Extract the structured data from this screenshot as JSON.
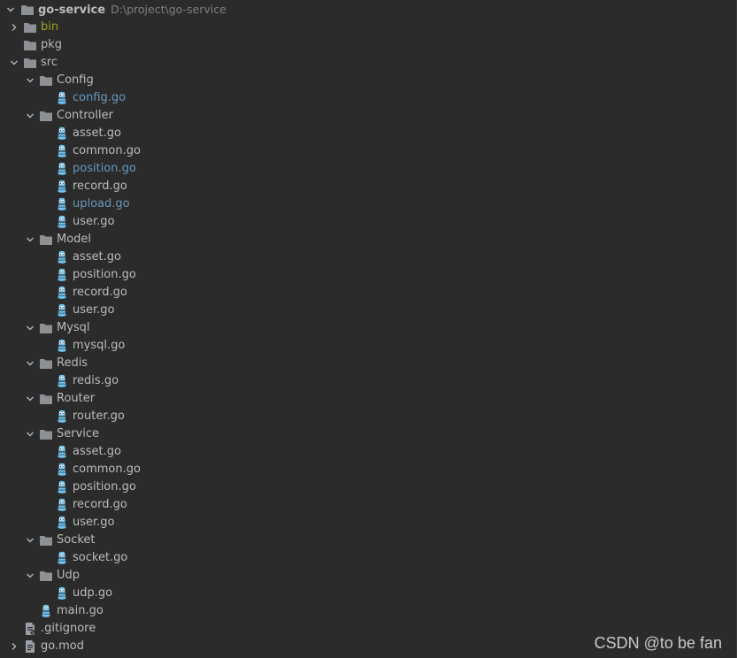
{
  "colors": {
    "background": "#2b2b2b",
    "text": "#bbbbbb",
    "modified_file": "#6897bb",
    "excluded_folder": "#a1a12a",
    "path_hint": "#808080",
    "folder_icon": "#8d9195",
    "go_file_icon": "#6fc3ee"
  },
  "project": {
    "name": "go-service",
    "path": "D:\\project\\go-service"
  },
  "tree": [
    {
      "label": "bin",
      "kind": "folder",
      "level": 1,
      "chevron": "right",
      "style": "excluded"
    },
    {
      "label": "pkg",
      "kind": "folder",
      "level": 1,
      "chevron": "none",
      "style": "normal"
    },
    {
      "label": "src",
      "kind": "folder",
      "level": 1,
      "chevron": "down",
      "style": "normal"
    },
    {
      "label": "Config",
      "kind": "folder",
      "level": 2,
      "chevron": "down",
      "style": "normal"
    },
    {
      "label": "config.go",
      "kind": "go",
      "level": 3,
      "chevron": "none",
      "style": "modified"
    },
    {
      "label": "Controller",
      "kind": "folder",
      "level": 2,
      "chevron": "down",
      "style": "normal"
    },
    {
      "label": "asset.go",
      "kind": "go",
      "level": 3,
      "chevron": "none",
      "style": "normal"
    },
    {
      "label": "common.go",
      "kind": "go",
      "level": 3,
      "chevron": "none",
      "style": "normal"
    },
    {
      "label": "position.go",
      "kind": "go",
      "level": 3,
      "chevron": "none",
      "style": "modified"
    },
    {
      "label": "record.go",
      "kind": "go",
      "level": 3,
      "chevron": "none",
      "style": "normal"
    },
    {
      "label": "upload.go",
      "kind": "go",
      "level": 3,
      "chevron": "none",
      "style": "modified"
    },
    {
      "label": "user.go",
      "kind": "go",
      "level": 3,
      "chevron": "none",
      "style": "normal"
    },
    {
      "label": "Model",
      "kind": "folder",
      "level": 2,
      "chevron": "down",
      "style": "normal"
    },
    {
      "label": "asset.go",
      "kind": "go",
      "level": 3,
      "chevron": "none",
      "style": "normal"
    },
    {
      "label": "position.go",
      "kind": "go",
      "level": 3,
      "chevron": "none",
      "style": "normal"
    },
    {
      "label": "record.go",
      "kind": "go",
      "level": 3,
      "chevron": "none",
      "style": "normal"
    },
    {
      "label": "user.go",
      "kind": "go",
      "level": 3,
      "chevron": "none",
      "style": "normal"
    },
    {
      "label": "Mysql",
      "kind": "folder",
      "level": 2,
      "chevron": "down",
      "style": "normal"
    },
    {
      "label": "mysql.go",
      "kind": "go",
      "level": 3,
      "chevron": "none",
      "style": "normal"
    },
    {
      "label": "Redis",
      "kind": "folder",
      "level": 2,
      "chevron": "down",
      "style": "normal"
    },
    {
      "label": "redis.go",
      "kind": "go",
      "level": 3,
      "chevron": "none",
      "style": "normal"
    },
    {
      "label": "Router",
      "kind": "folder",
      "level": 2,
      "chevron": "down",
      "style": "normal"
    },
    {
      "label": "router.go",
      "kind": "go",
      "level": 3,
      "chevron": "none",
      "style": "normal"
    },
    {
      "label": "Service",
      "kind": "folder",
      "level": 2,
      "chevron": "down",
      "style": "normal"
    },
    {
      "label": "asset.go",
      "kind": "go",
      "level": 3,
      "chevron": "none",
      "style": "normal"
    },
    {
      "label": "common.go",
      "kind": "go",
      "level": 3,
      "chevron": "none",
      "style": "normal"
    },
    {
      "label": "position.go",
      "kind": "go",
      "level": 3,
      "chevron": "none",
      "style": "normal"
    },
    {
      "label": "record.go",
      "kind": "go",
      "level": 3,
      "chevron": "none",
      "style": "normal"
    },
    {
      "label": "user.go",
      "kind": "go",
      "level": 3,
      "chevron": "none",
      "style": "normal"
    },
    {
      "label": "Socket",
      "kind": "folder",
      "level": 2,
      "chevron": "down",
      "style": "normal"
    },
    {
      "label": "socket.go",
      "kind": "go",
      "level": 3,
      "chevron": "none",
      "style": "normal"
    },
    {
      "label": "Udp",
      "kind": "folder",
      "level": 2,
      "chevron": "down",
      "style": "normal"
    },
    {
      "label": "udp.go",
      "kind": "go",
      "level": 3,
      "chevron": "none",
      "style": "normal"
    },
    {
      "label": "main.go",
      "kind": "go",
      "level": 2,
      "chevron": "none",
      "style": "normal"
    },
    {
      "label": ".gitignore",
      "kind": "gitignore",
      "level": 1,
      "chevron": "none",
      "style": "normal"
    },
    {
      "label": "go.mod",
      "kind": "gomod",
      "level": 1,
      "chevron": "right",
      "style": "normal"
    }
  ],
  "watermark": "CSDN @to be fan"
}
